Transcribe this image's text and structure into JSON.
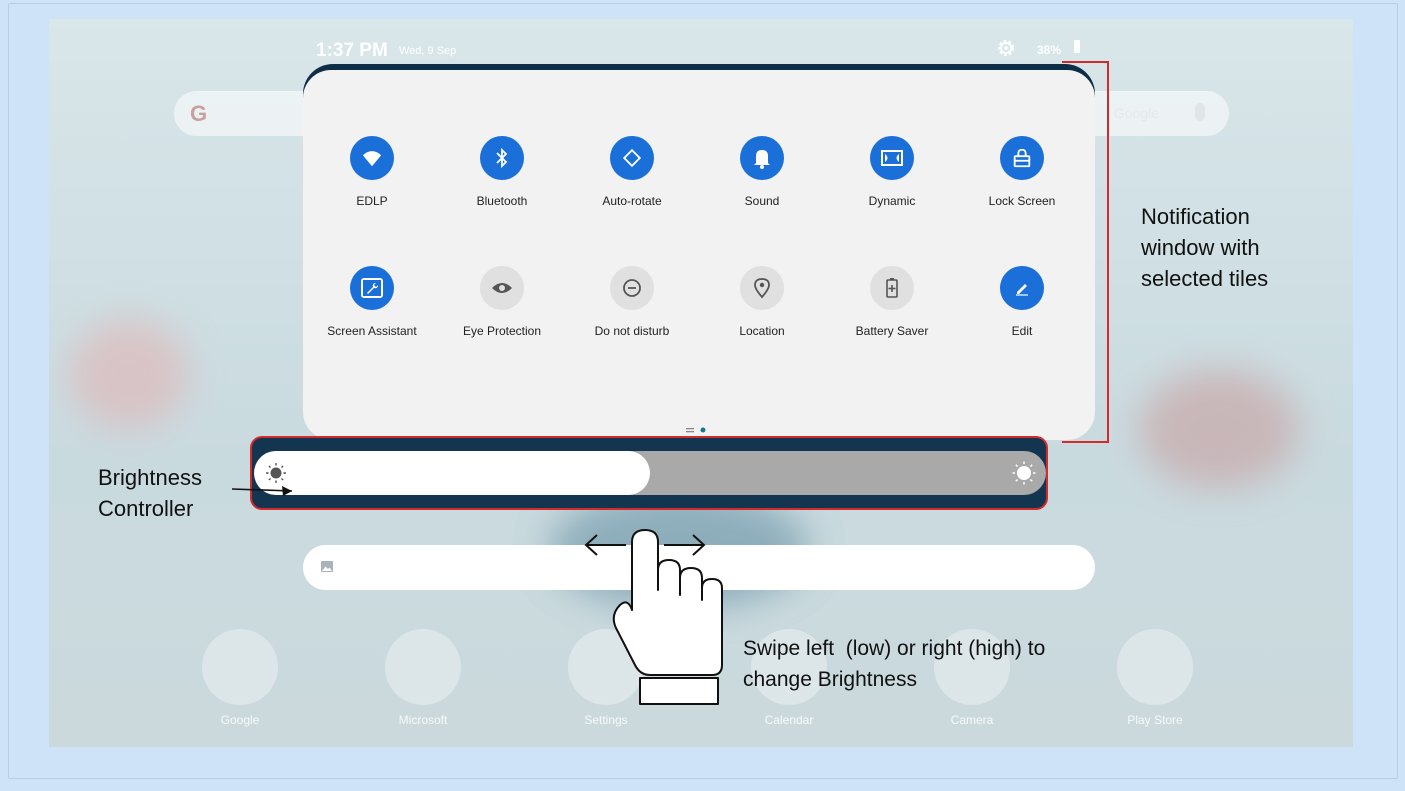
{
  "statusbar": {
    "time": "1:37 PM",
    "date": "Wed, 9 Sep",
    "battery": "38%",
    "settings_icon": "gear-icon",
    "battery_icon": "battery-icon"
  },
  "home": {
    "search_logo": "G",
    "search_hint": "Google"
  },
  "quick_settings": {
    "tiles": [
      {
        "label": "EDLP",
        "icon": "wifi-icon",
        "active": true
      },
      {
        "label": "Bluetooth",
        "icon": "bluetooth-icon",
        "active": true
      },
      {
        "label": "Auto-rotate",
        "icon": "rotate-icon",
        "active": true
      },
      {
        "label": "Sound",
        "icon": "bell-icon",
        "active": true
      },
      {
        "label": "Dynamic",
        "icon": "dolby-icon",
        "active": true
      },
      {
        "label": "Lock Screen",
        "icon": "lock-icon",
        "active": true
      },
      {
        "label": "Screen Assistant",
        "icon": "wrench-icon",
        "active": true
      },
      {
        "label": "Eye Protection",
        "icon": "eye-icon",
        "active": false
      },
      {
        "label": "Do not disturb",
        "icon": "do-not-disturb-icon",
        "active": false
      },
      {
        "label": "Location",
        "icon": "location-icon",
        "active": false
      },
      {
        "label": "Battery Saver",
        "icon": "battery-saver-icon",
        "active": false
      },
      {
        "label": "Edit",
        "icon": "edit-icon",
        "active": true
      }
    ],
    "page_count": 2,
    "current_page": 2
  },
  "brightness": {
    "level": 0.5
  },
  "dock": [
    {
      "label": "Google"
    },
    {
      "label": "Microsoft"
    },
    {
      "label": "Settings"
    },
    {
      "label": "Calendar"
    },
    {
      "label": "Camera"
    },
    {
      "label": "Play Store"
    }
  ],
  "annotations": {
    "notification_window": "Notification window with selected tiles",
    "notification_lines": [
      "Notification",
      "window with",
      "selected tiles"
    ],
    "brightness_lines": [
      "Brightness",
      "Controller"
    ],
    "swipe_lines": [
      "Swipe left  (low) or right (high) to",
      "change Brightness"
    ]
  },
  "colors": {
    "tile_active": "#1a6fd9",
    "tile_inactive": "#e0e0e0",
    "annotation_line": "#d32b2b"
  }
}
